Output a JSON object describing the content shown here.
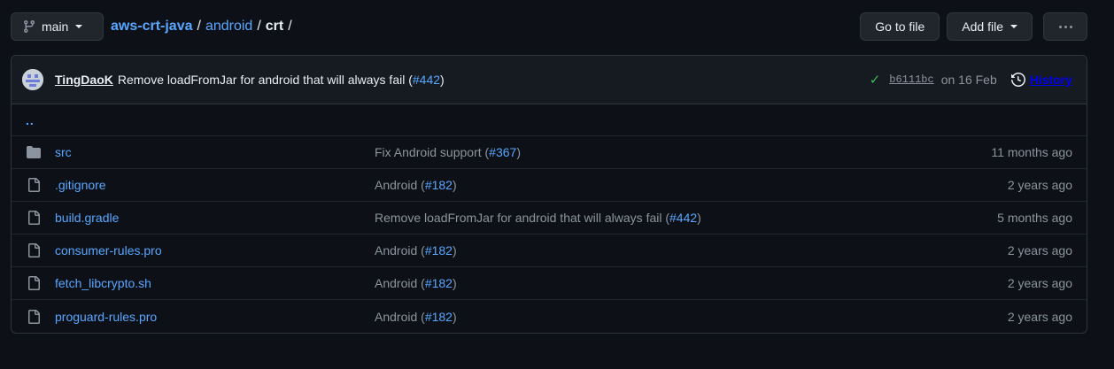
{
  "branch": {
    "label": "main",
    "icon": "git-branch-icon"
  },
  "breadcrumb": {
    "repo": "aws-crt-java",
    "sep1": "/",
    "dir": "android",
    "sep2": "/",
    "current": "crt",
    "sep3": "/"
  },
  "actions": {
    "go_to_file": "Go to file",
    "add_file": "Add file",
    "more_icon": "kebab-horizontal-icon"
  },
  "commit": {
    "author": "TingDaoK",
    "message": "Remove loadFromJar for android that will always fail (",
    "pr": "#442",
    "message_end": ")",
    "status_icon": "check-icon",
    "sha": "b6111bc",
    "date": "on 16 Feb",
    "history_label": "History",
    "history_icon": "history-icon"
  },
  "parent_link": "..",
  "files": [
    {
      "name": "src",
      "type": "dir",
      "icon": "folder-icon",
      "msg": "Fix Android support (",
      "pr": "#367",
      "msg_end": ")",
      "age": "11 months ago"
    },
    {
      "name": ".gitignore",
      "type": "file",
      "icon": "file-icon",
      "msg": "Android (",
      "pr": "#182",
      "msg_end": ")",
      "age": "2 years ago"
    },
    {
      "name": "build.gradle",
      "type": "file",
      "icon": "file-icon",
      "msg": "Remove loadFromJar for android that will always fail (",
      "pr": "#442",
      "msg_end": ")",
      "age": "5 months ago"
    },
    {
      "name": "consumer-rules.pro",
      "type": "file",
      "icon": "file-icon",
      "msg": "Android (",
      "pr": "#182",
      "msg_end": ")",
      "age": "2 years ago"
    },
    {
      "name": "fetch_libcrypto.sh",
      "type": "file",
      "icon": "file-icon",
      "msg": "Android (",
      "pr": "#182",
      "msg_end": ")",
      "age": "2 years ago"
    },
    {
      "name": "proguard-rules.pro",
      "type": "file",
      "icon": "file-icon",
      "msg": "Android (",
      "pr": "#182",
      "msg_end": ")",
      "age": "2 years ago"
    }
  ],
  "colors": {
    "bg": "#0d1117",
    "link": "#58a6ff",
    "muted": "#8b949e",
    "success": "#3fb950",
    "border": "#30363d"
  }
}
